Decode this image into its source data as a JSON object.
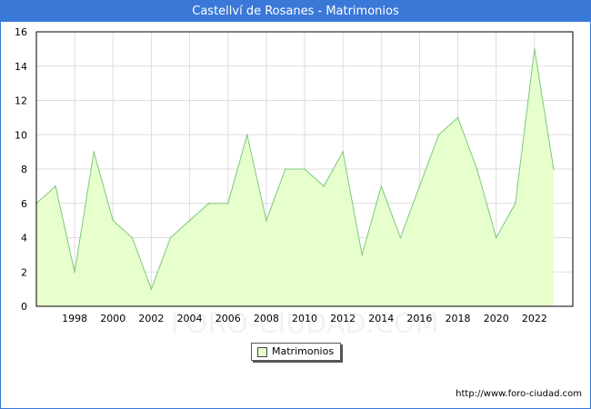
{
  "window": {
    "title": "Castellví de Rosanes - Matrimonios",
    "title_bar_color": "#3a78d8"
  },
  "footer": {
    "source": "http://www.foro-ciudad.com"
  },
  "watermark": "FORO-CIUDAD.COM",
  "chart_data": {
    "type": "area",
    "title": "Castellví de Rosanes - Matrimonios",
    "xlabel": "",
    "ylabel": "",
    "x": [
      1996,
      1997,
      1998,
      1999,
      2000,
      2001,
      2002,
      2003,
      2004,
      2005,
      2006,
      2007,
      2008,
      2009,
      2010,
      2011,
      2012,
      2013,
      2014,
      2015,
      2016,
      2017,
      2018,
      2019,
      2020,
      2021,
      2022,
      2023
    ],
    "series": [
      {
        "name": "Matrimonios",
        "values": [
          6,
          7,
          2,
          9,
          5,
          4,
          1,
          4,
          5,
          6,
          6,
          10,
          5,
          8,
          8,
          7,
          9,
          3,
          7,
          4,
          7,
          10,
          11,
          8,
          4,
          6,
          15,
          8
        ],
        "fill_color": "#e6ffcc",
        "line_color": "#7dc87d"
      }
    ],
    "xticks": [
      "1998",
      "2000",
      "2002",
      "2004",
      "2006",
      "2008",
      "2010",
      "2012",
      "2014",
      "2016",
      "2018",
      "2020",
      "2022"
    ],
    "yticks": [
      "0",
      "2",
      "4",
      "6",
      "8",
      "10",
      "12",
      "14",
      "16"
    ],
    "xlim": [
      1996,
      2024
    ],
    "ylim": [
      0,
      16
    ],
    "grid": true,
    "legend_position": "bottom-center"
  }
}
